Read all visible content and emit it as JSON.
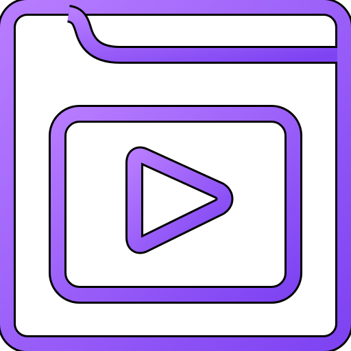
{
  "icon": {
    "name": "video-folder-icon",
    "colors": {
      "purple_light": "#B77CFF",
      "purple_mid": "#9B5CFF",
      "purple_dark": "#7E43F2",
      "outline": "#000000",
      "background": "#FFFFFF"
    }
  }
}
